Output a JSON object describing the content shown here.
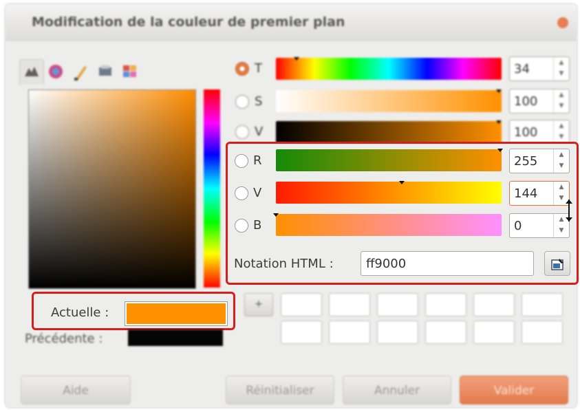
{
  "window": {
    "title": "Modification de la couleur de premier plan"
  },
  "tabs": [
    {
      "icon": "gimp-wilber-icon"
    },
    {
      "icon": "color-wheel-icon"
    },
    {
      "icon": "brush-icon"
    },
    {
      "icon": "printer-cmyk-icon"
    },
    {
      "icon": "palette-icon"
    }
  ],
  "hsv": [
    {
      "label": "T",
      "value": "34",
      "selected": true
    },
    {
      "label": "S",
      "value": "100",
      "selected": false
    },
    {
      "label": "V",
      "value": "100",
      "selected": false
    }
  ],
  "rgb": [
    {
      "label": "R",
      "value": "255"
    },
    {
      "label": "V",
      "value": "144"
    },
    {
      "label": "B",
      "value": "0"
    }
  ],
  "html_notation": {
    "label": "Notation HTML :",
    "value": "ff9000"
  },
  "current": {
    "label": "Actuelle :",
    "color": "#ff9000"
  },
  "previous": {
    "label": "Précédente :",
    "color": "#050505"
  },
  "history": {
    "add_label": "+"
  },
  "buttons": {
    "help": "Aide",
    "reset": "Réinitialiser",
    "cancel": "Annuler",
    "ok": "Valider"
  },
  "colors": {
    "accent": "#d81d1d",
    "selected": "#ff9000"
  }
}
